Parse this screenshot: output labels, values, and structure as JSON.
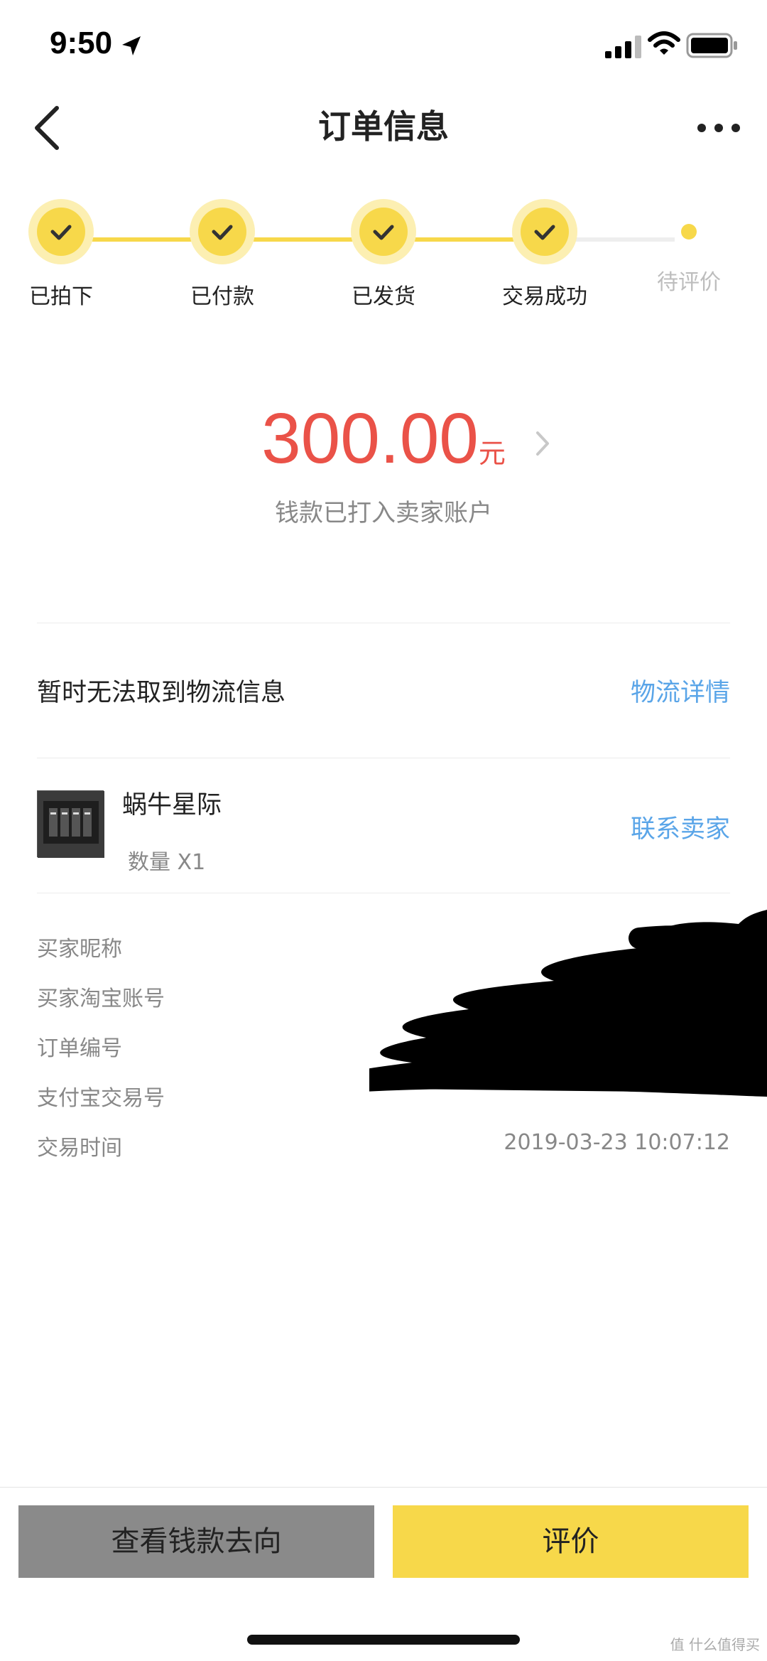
{
  "status_bar": {
    "time": "9:50"
  },
  "nav": {
    "title": "订单信息"
  },
  "progress": {
    "steps": [
      {
        "label": "已拍下",
        "state": "done"
      },
      {
        "label": "已付款",
        "state": "done"
      },
      {
        "label": "已发货",
        "state": "done"
      },
      {
        "label": "交易成功",
        "state": "done"
      },
      {
        "label": "待评价",
        "state": "pending"
      }
    ]
  },
  "amount": {
    "value": "300.00",
    "unit": "元",
    "note": "钱款已打入卖家账户"
  },
  "logistics": {
    "text": "暂时无法取到物流信息",
    "link": "物流详情"
  },
  "product": {
    "name": "蜗牛星际",
    "quantity": "数量 X1",
    "contact": "联系卖家"
  },
  "info": {
    "rows": [
      {
        "label": "买家昵称",
        "value": ""
      },
      {
        "label": "买家淘宝账号",
        "value": ""
      },
      {
        "label": "订单编号",
        "value": ""
      },
      {
        "label": "支付宝交易号",
        "value": ""
      },
      {
        "label": "交易时间",
        "value": "2019-03-23 10:07:12"
      }
    ]
  },
  "actions": {
    "left": "查看钱款去向",
    "right": "评价"
  },
  "watermark": "值 什么值得买",
  "colors": {
    "accent_yellow": "#f7d84a",
    "price_red": "#ea5248",
    "link_blue": "#5aa5e8"
  }
}
